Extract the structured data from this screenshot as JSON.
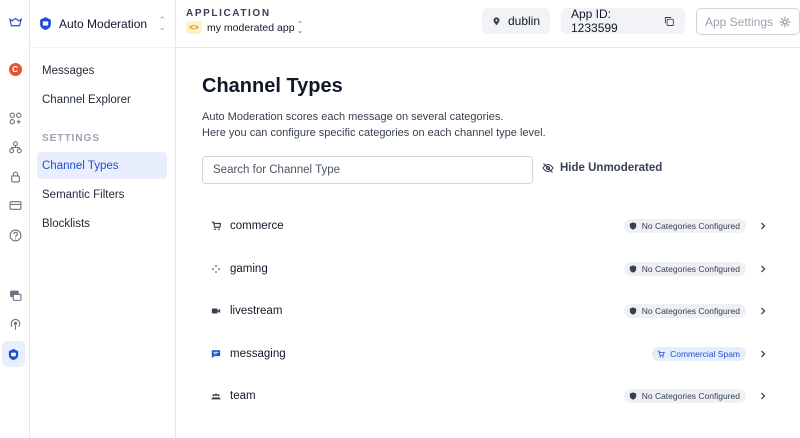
{
  "product": {
    "name": "Auto Moderation"
  },
  "header": {
    "app_label": "APPLICATION",
    "app_name": "my moderated app",
    "region": "dublin",
    "app_id": "App ID: 1233599",
    "settings_label": "App Settings"
  },
  "rail": {
    "avatar_letter": "C"
  },
  "sidebar": {
    "items": [
      {
        "label": "Messages"
      },
      {
        "label": "Channel Explorer"
      }
    ],
    "section_label": "SETTINGS",
    "settings_items": [
      {
        "label": "Channel Types",
        "active": true
      },
      {
        "label": "Semantic Filters"
      },
      {
        "label": "Blocklists"
      }
    ]
  },
  "main": {
    "title": "Channel Types",
    "description_line1": "Auto Moderation scores each message on several categories.",
    "description_line2": "Here you can configure specific categories on each channel type level.",
    "search_placeholder": "Search for Channel Type",
    "hide_unmoderated_label": "Hide Unmoderated",
    "channel_types": [
      {
        "name": "commerce",
        "icon": "cart-icon",
        "badge": "No Categories Configured"
      },
      {
        "name": "gaming",
        "icon": "gamepad-icon",
        "badge": "No Categories Configured"
      },
      {
        "name": "livestream",
        "icon": "video-icon",
        "badge": "No Categories Configured"
      },
      {
        "name": "messaging",
        "icon": "chat-icon",
        "badge": "Commercial Spam"
      },
      {
        "name": "team",
        "icon": "people-icon",
        "badge": "No Categories Configured"
      }
    ]
  },
  "colors": {
    "accent": "#1e4fd6",
    "accent_bg": "#e8eefc",
    "avatar": "#e4572e"
  }
}
